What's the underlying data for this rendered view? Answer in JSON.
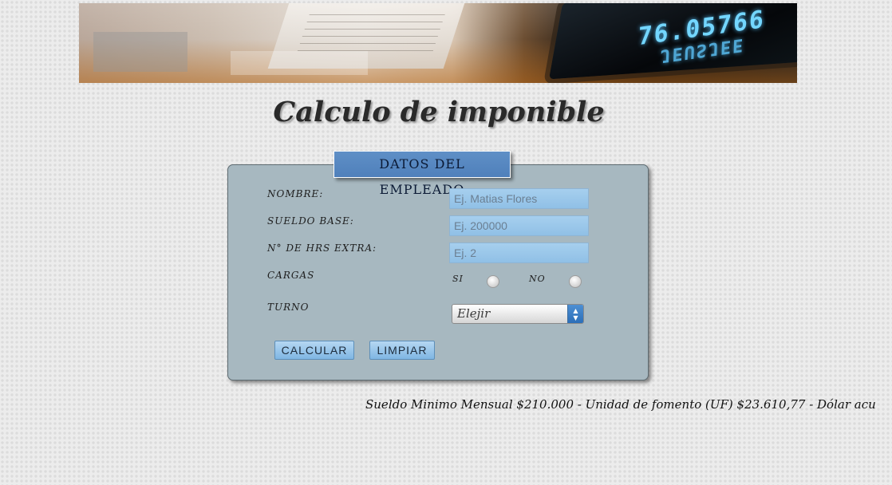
{
  "banner": {
    "digits_top": "76.05766",
    "digits_bottom": "JEUSJEE"
  },
  "page": {
    "title": "Calculo de imponible"
  },
  "form": {
    "legend": "DATOS DEL EMPLEADO",
    "nombre": {
      "label": "NOMBRE:",
      "placeholder": "Ej. Matias Flores"
    },
    "sueldo_base": {
      "label": "SUELDO BASE:",
      "placeholder": "Ej. 200000"
    },
    "hrs_extra": {
      "label": "N° DE HRS EXTRA:",
      "placeholder": "Ej. 2"
    },
    "cargas": {
      "label": "CARGAS",
      "option_si": "SI",
      "option_no": "NO"
    },
    "turno": {
      "label": "TURNO",
      "selected": "Elejir"
    },
    "buttons": {
      "calcular": "CALCULAR",
      "limpiar": "LIMPIAR"
    }
  },
  "ticker": {
    "text": "Sueldo Minimo Mensual $210.000 - Unidad de fomento (UF) $23.610,77 - Dólar acu"
  }
}
